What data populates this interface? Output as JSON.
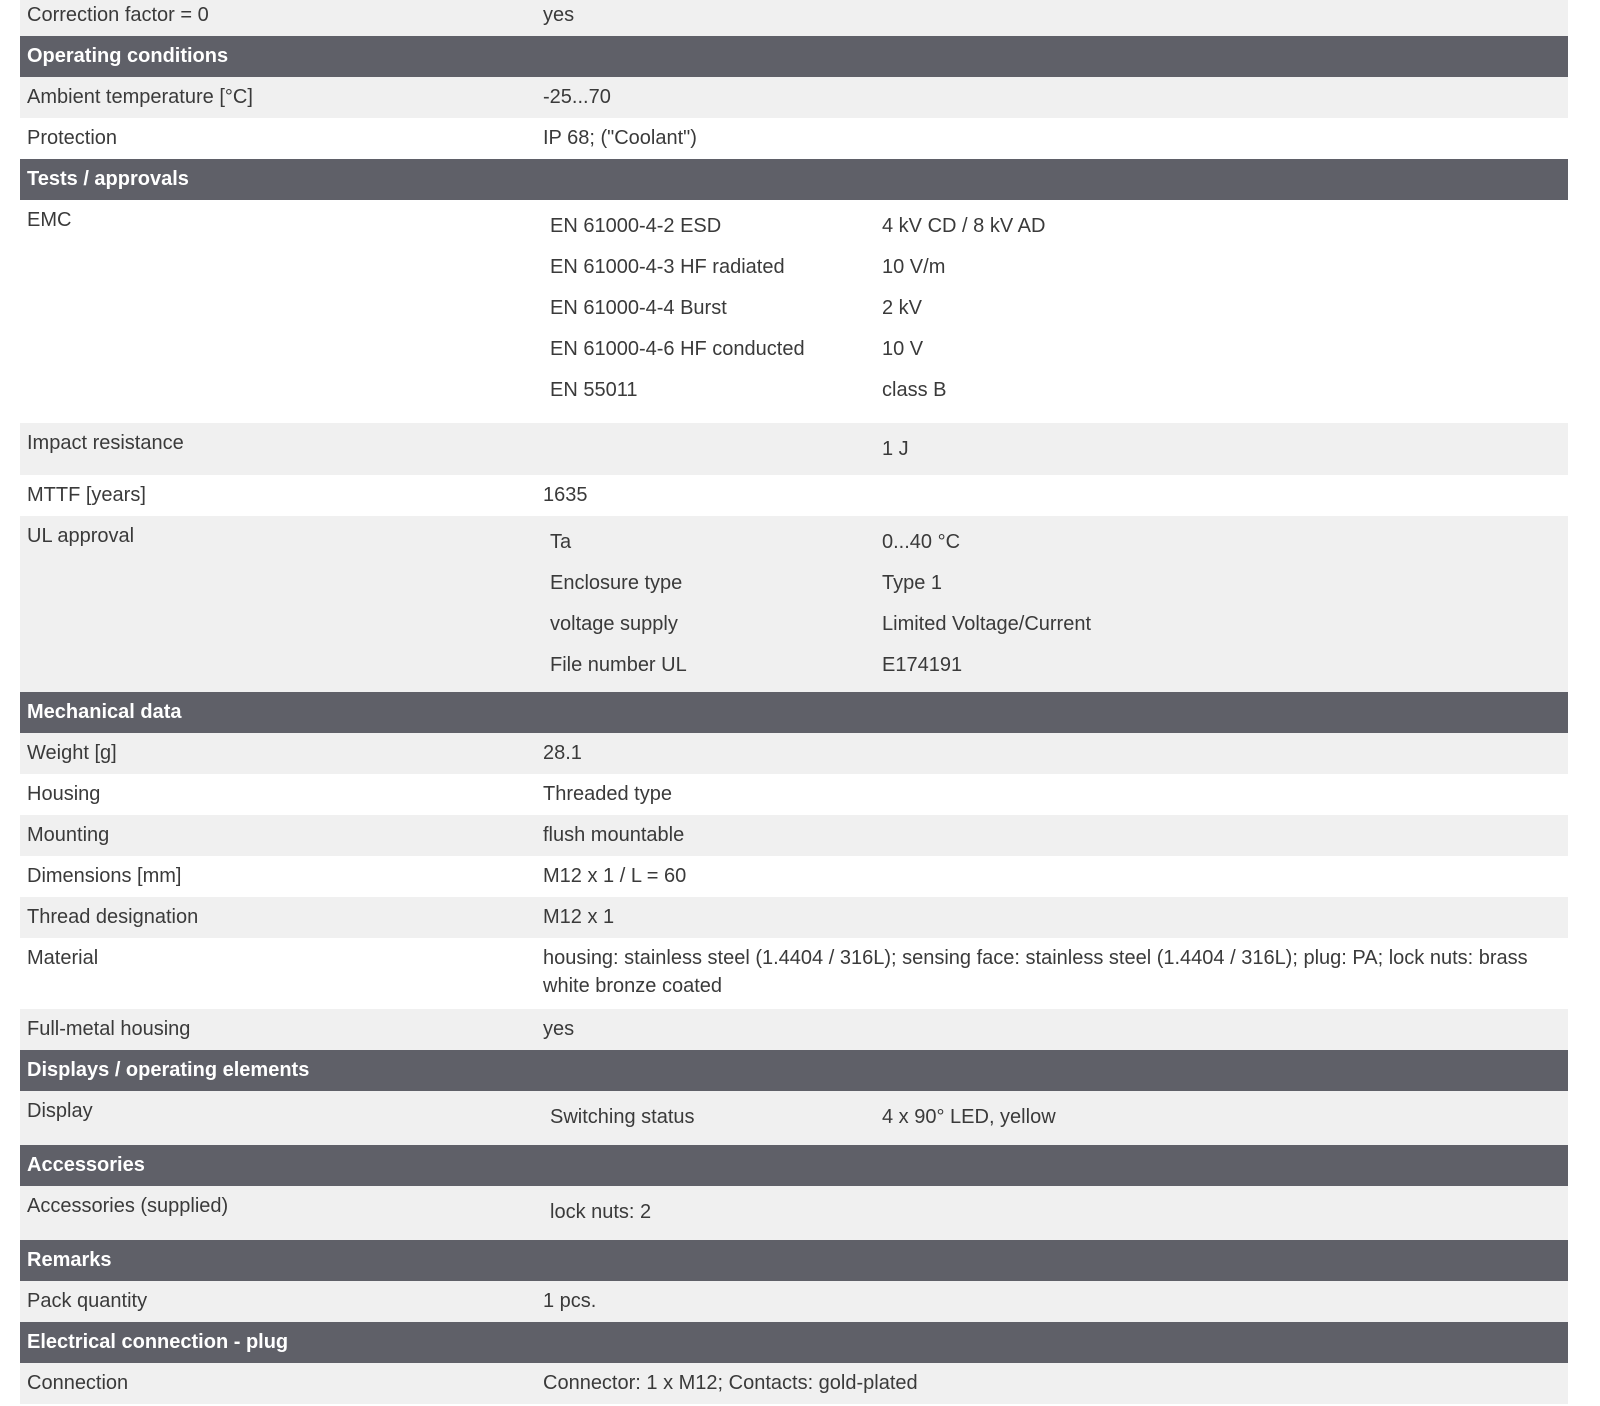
{
  "rows_top": [
    {
      "label": "Correction factor = 0",
      "value": "yes"
    }
  ],
  "operating_conditions": {
    "title": "Operating conditions",
    "rows": [
      {
        "label": "Ambient temperature [°C]",
        "value": "-25...70"
      },
      {
        "label": "Protection",
        "value": "IP 68; (\"Coolant\")"
      }
    ]
  },
  "tests_approvals": {
    "title": "Tests / approvals",
    "emc": {
      "label": "EMC",
      "items": [
        {
          "k": "EN 61000-4-2 ESD",
          "v": "4 kV CD / 8 kV AD"
        },
        {
          "k": "EN 61000-4-3 HF radiated",
          "v": "10 V/m"
        },
        {
          "k": "EN 61000-4-4 Burst",
          "v": "2 kV"
        },
        {
          "k": "EN 61000-4-6 HF conducted",
          "v": "10 V"
        },
        {
          "k": "EN 55011",
          "v": "class B"
        }
      ]
    },
    "impact": {
      "label": "Impact resistance",
      "k": "",
      "v": "1 J"
    },
    "mttf": {
      "label": "MTTF [years]",
      "value": "1635"
    },
    "ul": {
      "label": "UL approval",
      "items": [
        {
          "k": "Ta",
          "v": "0...40 °C"
        },
        {
          "k": "Enclosure type",
          "v": "Type 1"
        },
        {
          "k": "voltage supply",
          "v": "Limited Voltage/Current"
        },
        {
          "k": "File number UL",
          "v": "E174191"
        }
      ]
    }
  },
  "mechanical": {
    "title": "Mechanical data",
    "rows": [
      {
        "label": "Weight [g]",
        "value": "28.1"
      },
      {
        "label": "Housing",
        "value": "Threaded type"
      },
      {
        "label": "Mounting",
        "value": "flush mountable"
      },
      {
        "label": "Dimensions [mm]",
        "value": "M12 x 1 / L = 60"
      },
      {
        "label": "Thread designation",
        "value": "M12 x 1"
      },
      {
        "label": "Material",
        "value": "housing: stainless steel (1.4404 / 316L); sensing face: stainless steel (1.4404 / 316L); plug: PA; lock nuts: brass white bronze coated"
      },
      {
        "label": "Full-metal housing",
        "value": "yes"
      }
    ]
  },
  "displays": {
    "title": "Displays / operating elements",
    "display": {
      "label": "Display",
      "k": "Switching status",
      "v": "4 x 90° LED, yellow"
    }
  },
  "accessories": {
    "title": "Accessories",
    "supplied": {
      "label": "Accessories (supplied)",
      "k": "lock nuts: 2",
      "v": ""
    }
  },
  "remarks": {
    "title": "Remarks",
    "rows": [
      {
        "label": "Pack quantity",
        "value": "1 pcs."
      }
    ]
  },
  "electrical_connection": {
    "title": "Electrical connection - plug",
    "rows": [
      {
        "label": "Connection",
        "value": "Connector: 1 x M12; Contacts: gold-plated"
      }
    ]
  },
  "colors": {
    "header_bg": "#5f6068",
    "row_grey": "#f0f0f0",
    "row_white": "#ffffff",
    "text": "#3a3a3a"
  }
}
